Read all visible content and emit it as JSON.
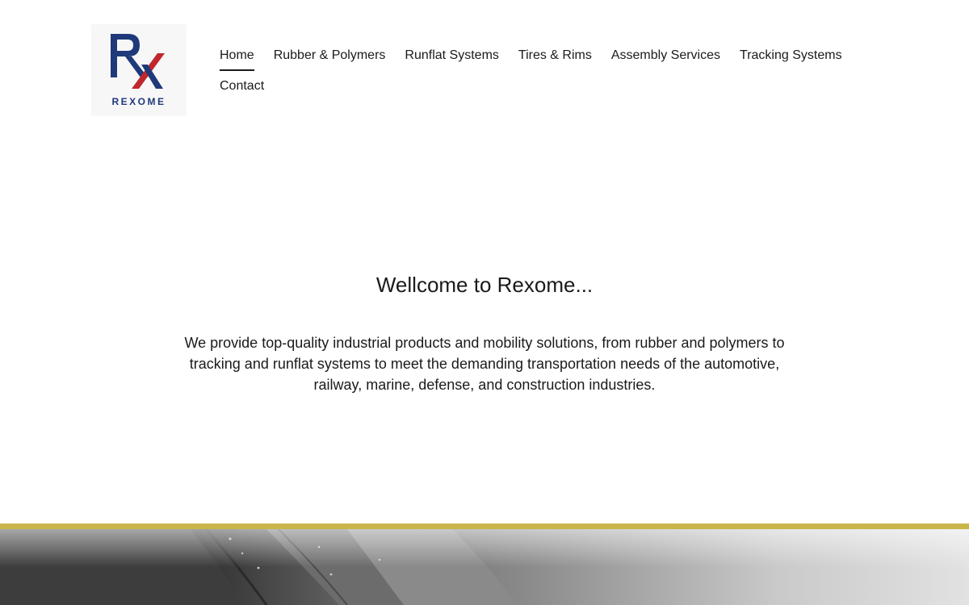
{
  "brand": {
    "logo_initials": "Rx",
    "logo_wordmark": "REXOME",
    "colors": {
      "navy": "#1f3a7a",
      "red": "#c0272d",
      "gold": "#c9b54a"
    }
  },
  "nav": {
    "items": [
      {
        "label": "Home",
        "active": true
      },
      {
        "label": "Rubber & Polymers"
      },
      {
        "label": "Runflat Systems"
      },
      {
        "label": "Tires & Rims"
      },
      {
        "label": "Assembly Services"
      },
      {
        "label": "Tracking Systems"
      },
      {
        "label": "Contact"
      }
    ]
  },
  "hero": {
    "title": "Wellcome to Rexome...",
    "body": "We provide top-quality industrial products and mobility solutions, from rubber and polymers to tracking and runflat systems to meet the demanding transportation needs of the automotive, railway, marine, defense, and construction industries."
  }
}
